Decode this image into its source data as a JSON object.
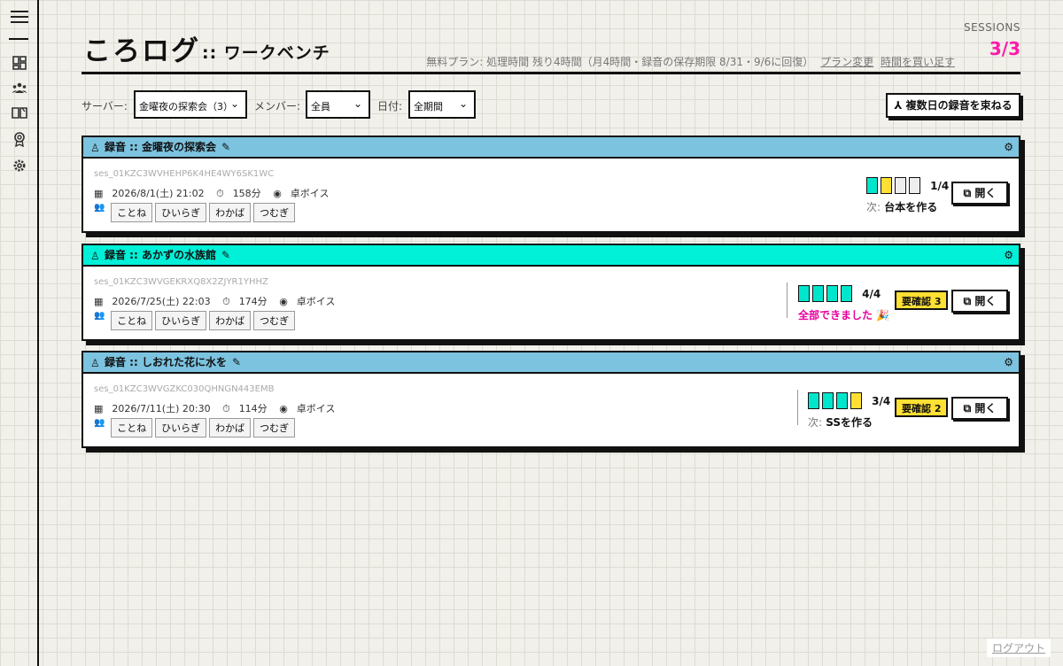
{
  "app": {
    "title": "ころログ",
    "subtitle": ":: ワークベンチ"
  },
  "plan": {
    "info": "無料プラン: 処理時間 残り4時間（月4時間・録音の保存期限 8/31・9/6に回復）",
    "change_link": "プラン変更",
    "buy_link": "時間を買い足す"
  },
  "sessions": {
    "label": "SESSIONS",
    "count": "3/3"
  },
  "filters": {
    "server_label": "サーバー:",
    "server_value": "金曜夜の探索会（3）",
    "member_label": "メンバー:",
    "member_value": "全員",
    "date_label": "日付:",
    "date_value": "全期間",
    "merge_button": "⅄ 複数日の録音を束ねる"
  },
  "colors": {
    "accent_blue": "#7cc3e0",
    "accent_cyan": "#00f0d8",
    "done_box": "#00e6cc",
    "pending_box": "#ffe033",
    "magenta": "#ff1aa9"
  },
  "cards": [
    {
      "header": "録音 :: 金曜夜の探索会",
      "session_id": "ses_01KZC3WVHEHP6K4HE4WY6SK1WC",
      "date": "2026/8/1(土) 21:02",
      "duration": "158分",
      "channel": "卓ボイス",
      "members": [
        "ことね",
        "ひいらぎ",
        "わかば",
        "つむぎ"
      ],
      "progress_text": "1/4",
      "next_label": "次:",
      "next_value": "台本を作る",
      "open_label": "開く"
    },
    {
      "header": "録音 :: あかずの水族館",
      "session_id": "ses_01KZC3WVGEKRXQ8X2ZJYR1YHHZ",
      "date": "2026/7/25(土) 22:03",
      "duration": "174分",
      "channel": "卓ボイス",
      "members": [
        "ことね",
        "ひいらぎ",
        "わかば",
        "つむぎ"
      ],
      "progress_text": "4/4",
      "done_text": "全部できました 🎉",
      "confirm_label": "要確認 3",
      "open_label": "開く"
    },
    {
      "header": "録音 :: しおれた花に水を",
      "session_id": "ses_01KZC3WVGZKC030QHNGN443EMB",
      "date": "2026/7/11(土) 20:30",
      "duration": "114分",
      "channel": "卓ボイス",
      "members": [
        "ことね",
        "ひいらぎ",
        "わかば",
        "つむぎ"
      ],
      "progress_text": "3/4",
      "next_label": "次:",
      "next_value": "SSを作る",
      "confirm_label": "要確認 2",
      "open_label": "開く"
    }
  ],
  "footer": {
    "logout": "ログアウト"
  }
}
